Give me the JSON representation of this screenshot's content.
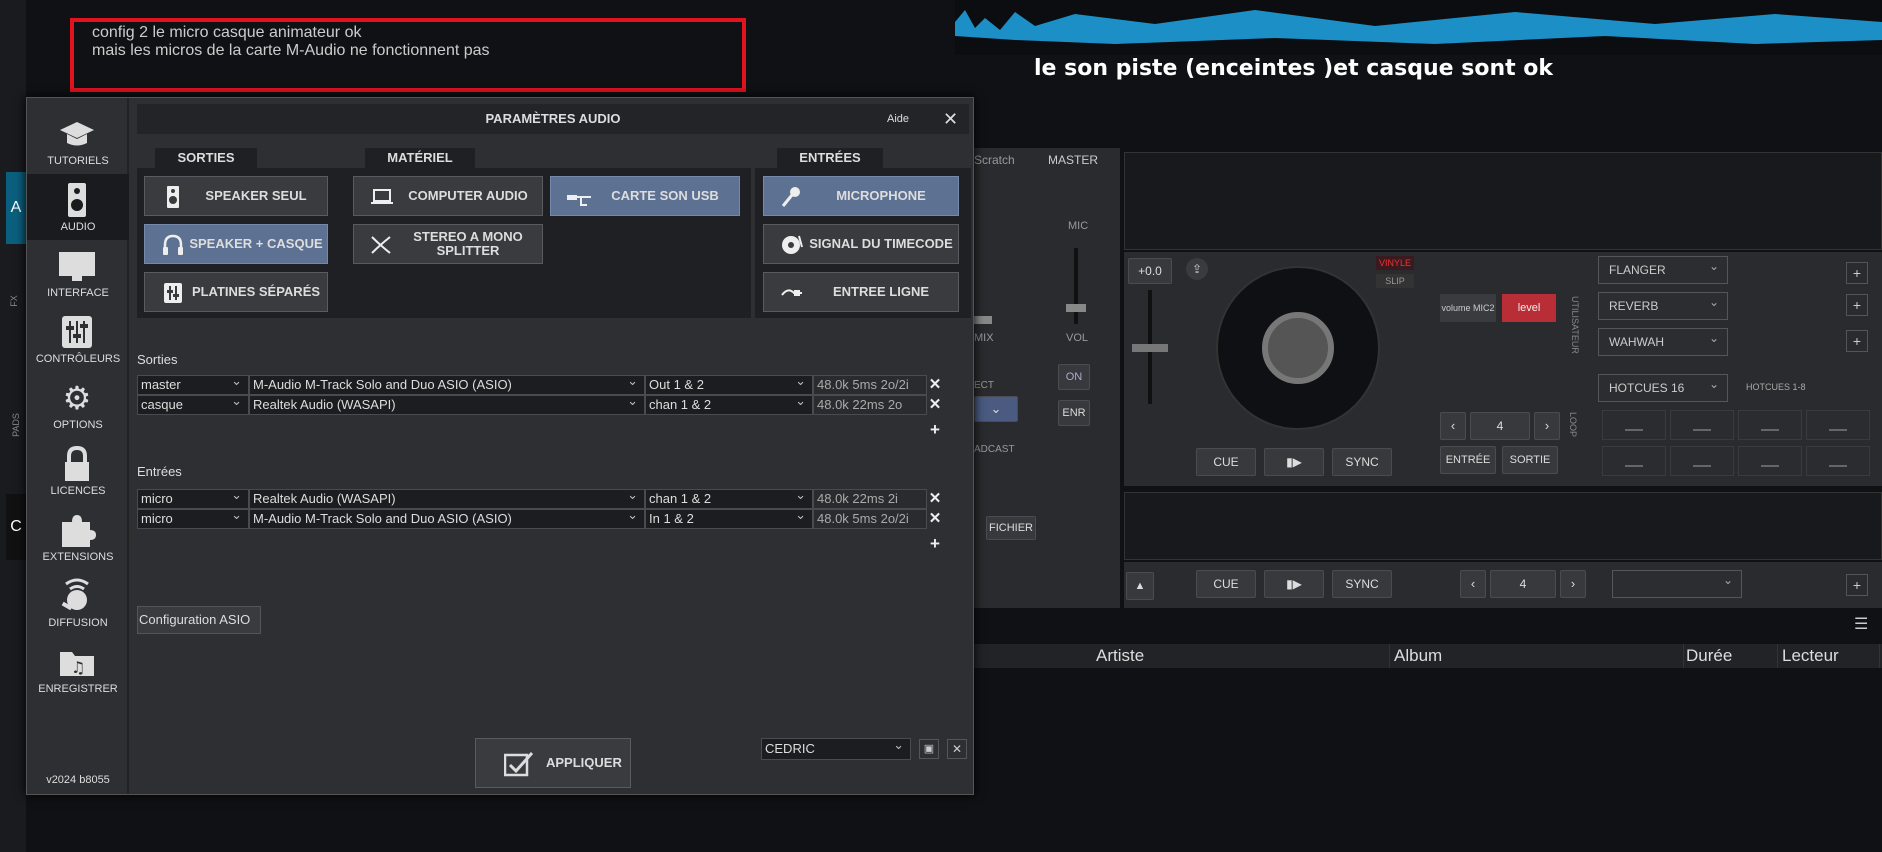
{
  "annotations": {
    "left_line1": "config 2 le micro casque animateur ok",
    "left_line2": "mais les micros de la carte M-Audio ne fonctionnent pas",
    "right": "le son piste (enceintes )et casque sont ok"
  },
  "background": {
    "tab_scratch": "Scratch",
    "tab_master": "MASTER",
    "mic_label": "MIC",
    "vol_label": "VOL",
    "mix_label": "MIX",
    "on_label": "ON",
    "enr_label": "ENR",
    "fichier_label": "FICHIER",
    "ect_label": "ECT",
    "adcast_label": "ADCAST",
    "pitch_value": "+0.0",
    "vinyle": "VINYLE",
    "slip": "SLIP",
    "volume_mic2": "volume MIC2",
    "level": "level",
    "utilisateur": "UTILISATEUR",
    "loop": "LOOP",
    "fx": [
      "FLANGER",
      "REVERB",
      "WAHWAH"
    ],
    "hotcues_select": "HOTCUES 16",
    "hotcues_label": "HOTCUES 1-8",
    "loop_value": "4",
    "deck2_loop_value": "4",
    "cue": "CUE",
    "sync": "SYNC",
    "entree": "ENTRÉE",
    "sortie": "SORTIE",
    "fx_side_label": "FX",
    "pads_side_label": "PADS",
    "columns": [
      "Artiste",
      "Album",
      "Durée",
      "Lecteur"
    ],
    "side_tab_a": "A",
    "side_tab_c": "C"
  },
  "dialog": {
    "title": "PARAMÈTRES AUDIO",
    "help": "Aide",
    "close_icon": "close-icon",
    "version": "v2024 b8055",
    "sidebar": [
      {
        "label": "TUTORIELS",
        "icon": "graduation-cap-icon"
      },
      {
        "label": "AUDIO",
        "icon": "speaker-icon"
      },
      {
        "label": "INTERFACE",
        "icon": "monitor-icon"
      },
      {
        "label": "CONTRÔLEURS",
        "icon": "sliders-icon"
      },
      {
        "label": "OPTIONS",
        "icon": "gear-icon"
      },
      {
        "label": "LICENCES",
        "icon": "lock-icon"
      },
      {
        "label": "EXTENSIONS",
        "icon": "puzzle-icon"
      },
      {
        "label": "DIFFUSION",
        "icon": "broadcast-icon"
      },
      {
        "label": "ENREGISTRER",
        "icon": "music-folder-icon"
      }
    ],
    "groups": {
      "sorties": "SORTIES",
      "materiel": "MATÉRIEL",
      "entrees": "ENTRÉES"
    },
    "sorties_buttons": [
      "SPEAKER SEUL",
      "SPEAKER + CASQUE",
      "PLATINES SÉPARÉS"
    ],
    "materiel_buttons": [
      "COMPUTER AUDIO",
      "CARTE SON USB",
      "STEREO A MONO SPLITTER"
    ],
    "entrees_buttons": [
      "MICROPHONE",
      "SIGNAL DU TIMECODE",
      "ENTREE LIGNE"
    ],
    "sorties_label": "Sorties",
    "entrees_label": "Entrées",
    "outputs": [
      {
        "name": "master",
        "device": "M-Audio M-Track Solo and Duo ASIO (ASIO)",
        "channel": "Out 1 & 2",
        "info": "48.0k 5ms 2o/2i"
      },
      {
        "name": "casque",
        "device": "Realtek Audio (WASAPI)",
        "channel": "chan 1 & 2",
        "info": "48.0k 22ms 2o"
      }
    ],
    "inputs": [
      {
        "name": "micro",
        "device": "Realtek Audio (WASAPI)",
        "channel": "chan 1 & 2",
        "info": "48.0k 22ms 2i"
      },
      {
        "name": "micro",
        "device": "M-Audio M-Track Solo and Duo ASIO (ASIO)",
        "channel": "In 1 & 2",
        "info": "48.0k 5ms 2o/2i"
      }
    ],
    "asio_button": "Configuration ASIO",
    "apply_button": "APPLIQUER",
    "profile": "CEDRIC"
  }
}
